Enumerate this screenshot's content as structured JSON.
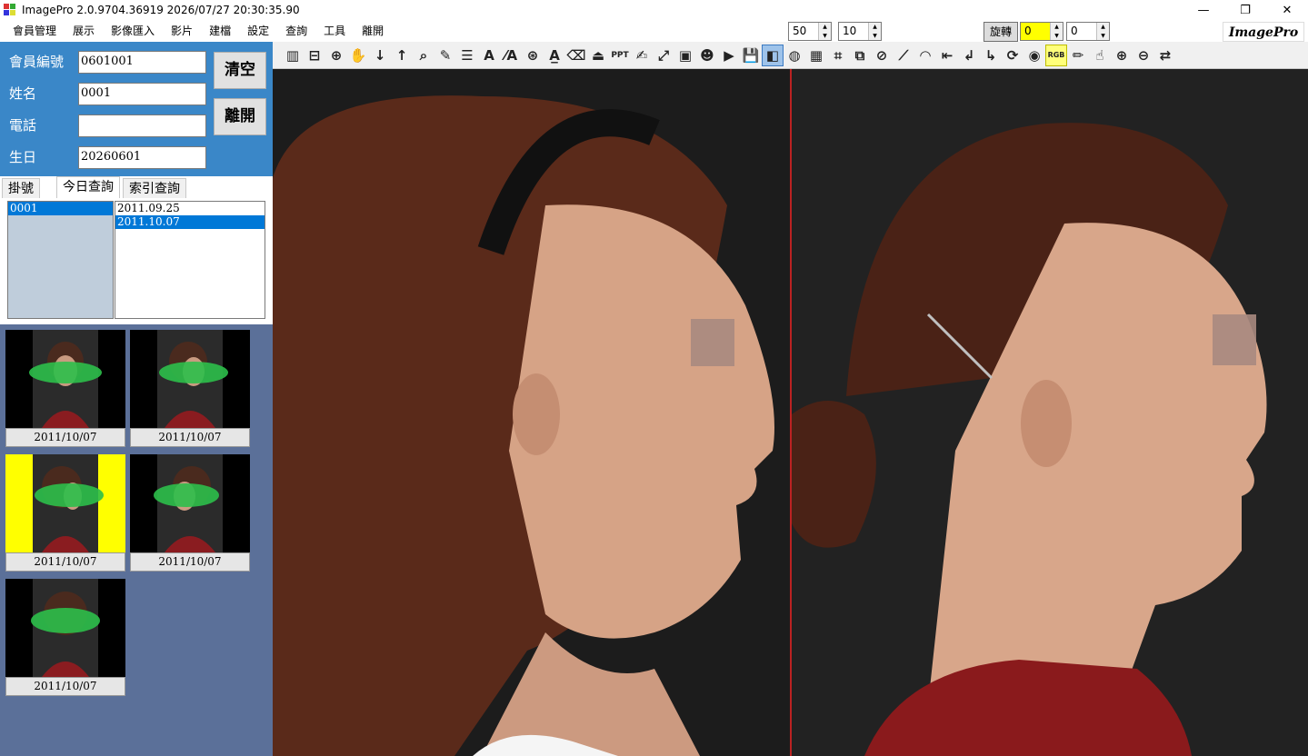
{
  "window": {
    "title": "ImagePro 2.0.9704.36919 2026/07/27 20:30:35.90",
    "minimize": "—",
    "maximize": "❐",
    "close": "✕"
  },
  "menu": [
    "會員管理",
    "展示",
    "影像匯入",
    "影片",
    "建檔",
    "設定",
    "查詢",
    "工具",
    "離開"
  ],
  "controls": {
    "spin1": "50",
    "spin2": "10",
    "rotate_label": "旋轉",
    "rotate_value": "0",
    "rotate_value2": "0",
    "brand": "ImagePro",
    "rotate_highlight_color": "#ffff00"
  },
  "member": {
    "id_label": "會員編號",
    "id_value": "0601001",
    "name_label": "姓名",
    "name_value": "0001",
    "phone_label": "電話",
    "phone_value": "",
    "birthday_label": "生日",
    "birthday_value": "20260601",
    "clear_button": "清空",
    "exit_button": "離開"
  },
  "tabs": [
    "掛號",
    "今日查詢",
    "索引查詢"
  ],
  "list_members": [
    "0001"
  ],
  "list_dates": [
    "2011.09.25",
    "2011.10.07"
  ],
  "thumbnails": [
    {
      "date": "2011/10/07",
      "view": "front",
      "selected": false
    },
    {
      "date": "2011/10/07",
      "view": "three-quarter",
      "selected": false
    },
    {
      "date": "2011/10/07",
      "view": "profile",
      "selected": true
    },
    {
      "date": "2011/10/07",
      "view": "three-quarter-left",
      "selected": false
    },
    {
      "date": "2011/10/07",
      "view": "back-profile",
      "selected": false
    }
  ],
  "toolbar_icons": [
    "layout-icon",
    "stamp-icon",
    "search-person-icon",
    "hand-icon",
    "arrow-down-icon",
    "arrow-up-icon",
    "magnify-icon",
    "pen-icon",
    "line-style-icon",
    "text-icon",
    "text-angle-icon",
    "text-zoom-icon",
    "text-underline-icon",
    "eraser-icon",
    "seal-icon",
    "ppt-icon",
    "edit-icon",
    "fullscreen-icon",
    "portrait-icon",
    "person-icon",
    "play-icon",
    "save-icon",
    "compare-icon",
    "color-drop-icon",
    "grid-icon",
    "crop-icon",
    "resize-icon",
    "no-icon",
    "ruler-icon",
    "protractor-icon",
    "back-icon",
    "turn-left-icon",
    "turn-right-icon",
    "rotate-icon",
    "camera-icon",
    "rgb-icon",
    "draw-icon",
    "hand-select-icon",
    "zoom-in-icon",
    "zoom-out-icon",
    "swap-icon"
  ],
  "toolbar_labels": {
    "ppt": "PPT",
    "rgb": "RGB"
  },
  "viewers": [
    {
      "name": "left-photo",
      "subject": "side profile with headband"
    },
    {
      "name": "right-photo",
      "subject": "side profile with ponytail"
    }
  ]
}
